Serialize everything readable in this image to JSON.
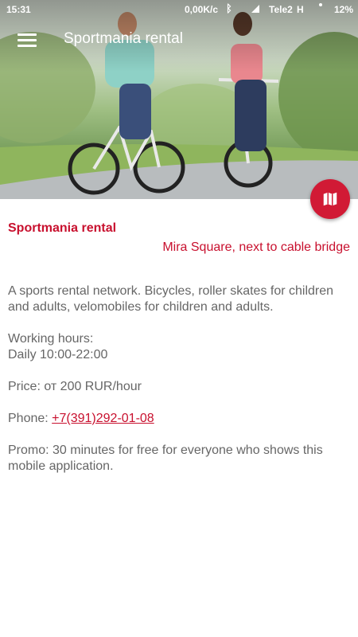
{
  "status_bar": {
    "time": "15:31",
    "net_speed": "0,00K/c",
    "carrier": "Tele2",
    "network_type": "H",
    "battery": "12%"
  },
  "app_bar": {
    "title": "Sportmania rental",
    "menu_icon": "hamburger-menu-icon"
  },
  "fab": {
    "icon": "map-icon",
    "color": "#d11a35"
  },
  "place": {
    "name": "Sportmania rental",
    "address": "Mira Square, next to cable bridge",
    "description": "A sports rental network. Bicycles, roller skates for children and adults, velomobiles for children and adults.",
    "hours_label": "Working hours:",
    "hours_value": "Daily 10:00-22:00",
    "price": "Price: от 200 RUR/hour",
    "phone_label": "Phone: ",
    "phone": "+7(391)292-01-08",
    "promo": "Promo: 30 minutes for free for everyone who shows this mobile application."
  },
  "colors": {
    "accent": "#c8102e",
    "text": "#666666"
  }
}
